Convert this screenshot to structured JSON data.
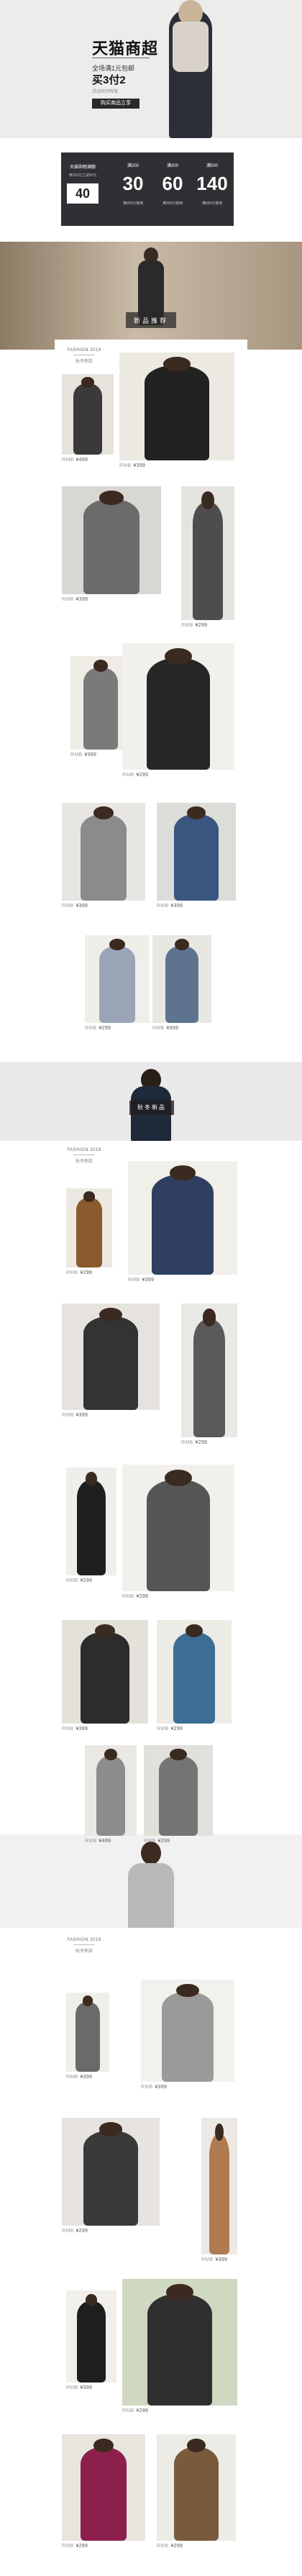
{
  "hero": {
    "title": "天猫商超",
    "subtitle": "全场满1元包邮",
    "offer": "买3付2",
    "sub_small": "活动时间有限",
    "button_label": "购买商品立享"
  },
  "coupons": {
    "left_title": "天猫购物满额",
    "left_sub": "满200元立减40元",
    "left_amount": "40",
    "items": [
      {
        "top": "满200",
        "value": "30",
        "bottom": "满200元使用"
      },
      {
        "top": "满300",
        "value": "60",
        "bottom": "满300元使用"
      },
      {
        "top": "满500",
        "value": "140",
        "bottom": "满500元使用"
      }
    ]
  },
  "sections": [
    {
      "banner_label": "新品推荐",
      "brand_title": "FASHION 2019",
      "brand_sub": "秋冬新款"
    },
    {
      "banner_label": "秋冬新品",
      "brand_title": "FASHION 2019",
      "brand_sub": "秋冬新款"
    },
    {
      "banner_label": "",
      "brand_title": "FASHION 2019",
      "brand_sub": "秋冬新款"
    }
  ],
  "prices": [
    "¥499",
    "¥399",
    "¥399",
    "¥299",
    "¥399",
    "¥299",
    "¥399",
    "¥399",
    "¥299",
    "¥399",
    "¥299",
    "¥399",
    "¥399",
    "¥299",
    "¥299",
    "¥299",
    "¥399",
    "¥299",
    "¥499",
    "¥299",
    "¥399",
    "¥399",
    "¥299",
    "¥399",
    "¥399",
    "¥299",
    "¥299",
    "¥299"
  ],
  "currency_label": "RMB"
}
